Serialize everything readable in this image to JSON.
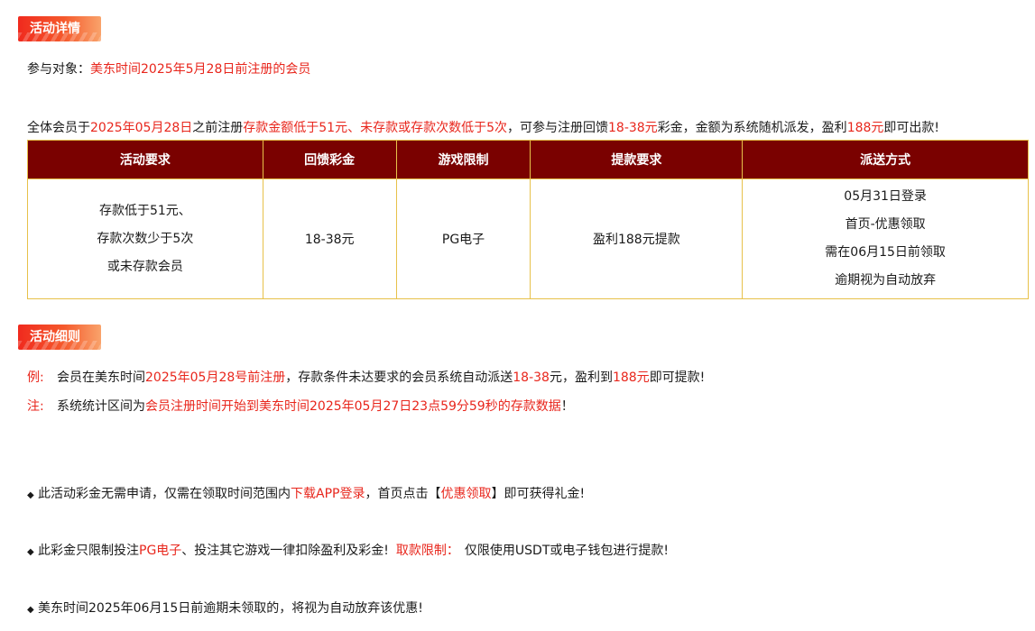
{
  "section1": {
    "badge": "活动详情",
    "target_label": "参与对象：",
    "target_value": "美东时间2025年5月28日前注册的会员",
    "intro": {
      "p1": "全体会员于",
      "p2": "2025年05月28日",
      "p3": "之前注册",
      "p4": "存款金额低于51元、未存款或存款次数低于5次",
      "p5": "，可参与注册回馈",
      "p6": "18-38元",
      "p7": "彩金，金额为系统随机派发，盈利",
      "p8": "188元",
      "p9": "即可出款!"
    }
  },
  "table": {
    "headers": [
      "活动要求",
      "回馈彩金",
      "游戏限制",
      "提款要求",
      "派送方式"
    ],
    "requirement_lines": [
      "存款低于51元、",
      "存款次数少于5次",
      "或未存款会员"
    ],
    "bonus": "18-38元",
    "game": "PG电子",
    "withdraw": "盈利188元提款",
    "delivery_lines": [
      "05月31日登录",
      "首页-优惠领取",
      "需在06月15日前领取",
      "逾期视为自动放弃"
    ]
  },
  "section2": {
    "badge": "活动细则",
    "example": {
      "label": "例:",
      "p1": "会员在美东时间",
      "p2": "2025年05月28号前注册",
      "p3": "，存款条件未达要求的会员系统自动派送",
      "p4": "18-38",
      "p5": "元，盈利到",
      "p6": "188元",
      "p7": "即可提款!"
    },
    "note": {
      "label": "注:",
      "p1": "系统统计区间为",
      "p2": "会员注册时间开始到美东时间2025年05月27日23点59分59秒的存款数据",
      "p3": "！"
    }
  },
  "bullets": {
    "b1": {
      "p1": "此活动彩金无需申请，仅需在领取时间范围内",
      "p2": "下载APP登录",
      "p3": "，首页点击【",
      "p4": "优惠领取",
      "p5": "】即可获得礼金!"
    },
    "b2": {
      "p1": "此彩金只限制投注",
      "p2": "PG电子",
      "p3": "、投注其它游戏一律扣除盈利及彩金!",
      "p4": "取款限制：",
      "p5": "仅限使用USDT或电子钱包进行提款!"
    },
    "b3": {
      "p1": "美东时间2025年06月15日前逾期未领取的，将视为自动放弃该优惠!"
    }
  },
  "colors": {
    "accent_red": "#e8261c",
    "header_bg": "#7a0100",
    "table_border": "#e7c14a"
  },
  "icons": {
    "bullet": "diamond-bullet-icon"
  }
}
